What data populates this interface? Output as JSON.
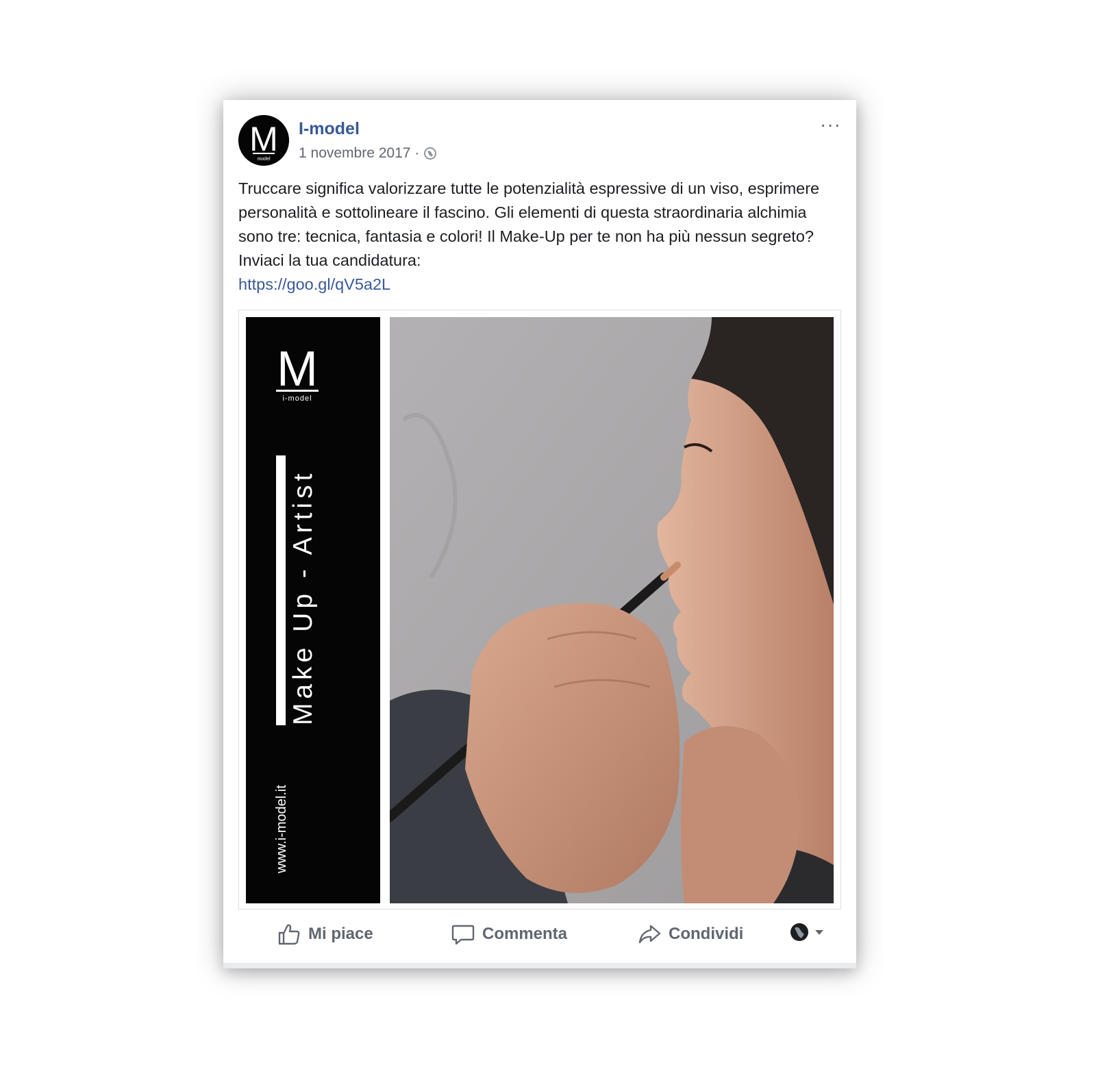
{
  "post": {
    "page_name": "I-model",
    "date": "1 novembre 2017 ·",
    "body_text": "Truccare significa valorizzare tutte le potenzialità espressive di un viso, esprimere personalità e sottolineare il fascino. Gli elementi di questa straordinaria alchimia sono tre: tecnica, fantasia e colori! Il Make-Up per te non ha più nessun segreto? Inviaci la tua candidatura:",
    "link_text": "https://goo.gl/qV5a2L",
    "more_label": "···"
  },
  "image": {
    "logo_letter": "M",
    "logo_caption": "i-model",
    "avatar_caption": "model",
    "headline": "Make Up - Artist",
    "website": "www.i-model.it"
  },
  "actions": {
    "like_label": "Mi piace",
    "comment_label": "Commenta",
    "share_label": "Condividi"
  },
  "colors": {
    "link_blue": "#385898",
    "text": "#1c1e21",
    "secondary": "#606770",
    "panel_black": "#050505"
  }
}
